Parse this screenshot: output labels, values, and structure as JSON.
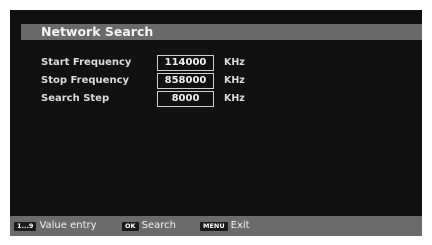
{
  "title": "Network Search",
  "fields": [
    {
      "label": "Start Frequency",
      "value": "114000",
      "unit": "KHz"
    },
    {
      "label": "Stop Frequency",
      "value": "858000",
      "unit": "KHz"
    },
    {
      "label": "Search Step",
      "value": "8000",
      "unit": "KHz"
    }
  ],
  "footer": {
    "hints": [
      {
        "key": "1...9",
        "text": "Value entry"
      },
      {
        "key": "OK",
        "text": "Search"
      },
      {
        "key": "MENU",
        "text": "Exit"
      }
    ]
  }
}
